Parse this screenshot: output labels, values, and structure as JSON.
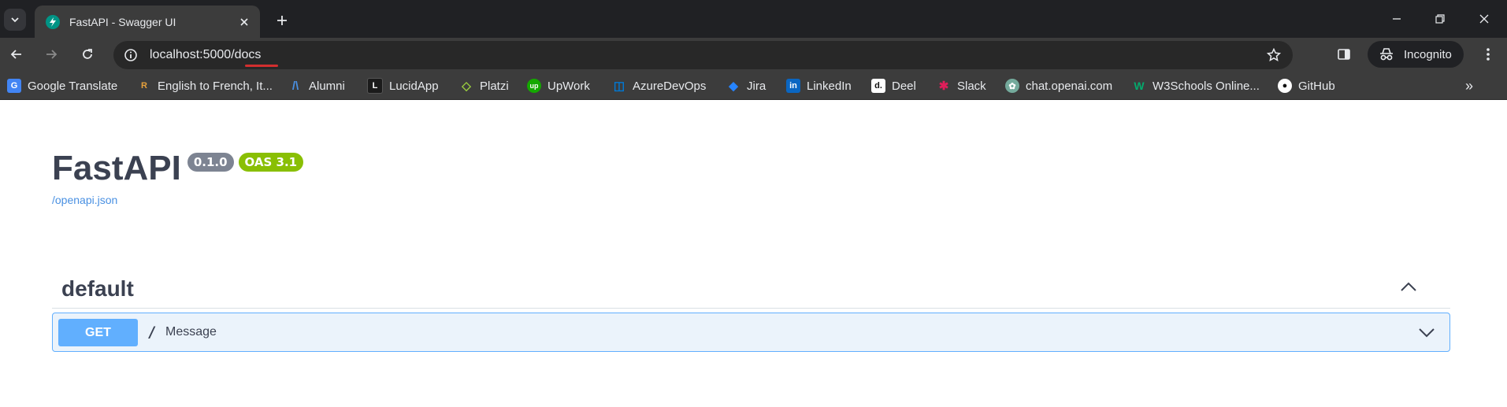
{
  "browser": {
    "tab": {
      "title": "FastAPI - Swagger UI"
    },
    "url": {
      "host": "localhost:5000",
      "path": "/docs"
    },
    "profile_label": "Incognito",
    "bookmarks": [
      {
        "label": "Google Translate",
        "icon": "google-translate-icon",
        "color": "#4285f4"
      },
      {
        "label": "English to French, It...",
        "icon": "reverso-icon",
        "color": "#e8eaed"
      },
      {
        "label": "Alumni",
        "icon": "alumni-icon",
        "color": "#4a90e2"
      },
      {
        "label": "LucidApp",
        "icon": "lucid-icon",
        "color": "#282c33"
      },
      {
        "label": "Platzi",
        "icon": "platzi-icon",
        "color": "#98ca3f"
      },
      {
        "label": "UpWork",
        "icon": "upwork-icon",
        "color": "#14a800"
      },
      {
        "label": "AzureDevOps",
        "icon": "azure-devops-icon",
        "color": "#0078d4"
      },
      {
        "label": "Jira",
        "icon": "jira-icon",
        "color": "#2684ff"
      },
      {
        "label": "LinkedIn",
        "icon": "linkedin-icon",
        "color": "#0a66c2"
      },
      {
        "label": "Deel",
        "icon": "deel-icon",
        "color": "#ffffff"
      },
      {
        "label": "Slack",
        "icon": "slack-icon",
        "color": "#e01e5a"
      },
      {
        "label": "chat.openai.com",
        "icon": "openai-icon",
        "color": "#74aa9c"
      },
      {
        "label": "W3Schools Online...",
        "icon": "w3schools-icon",
        "color": "#04aa6d"
      },
      {
        "label": "GitHub",
        "icon": "github-icon",
        "color": "#ffffff"
      }
    ]
  },
  "swagger": {
    "title": "FastAPI",
    "version": "0.1.0",
    "oas": "OAS 3.1",
    "spec_link": "/openapi.json",
    "section": {
      "title": "default"
    },
    "operation": {
      "method": "GET",
      "path": "/",
      "summary": "Message"
    },
    "colors": {
      "get": "#61affe",
      "get_bg": "#ebf3fb",
      "version_badge": "#7d8492",
      "oas_badge": "#89bf04"
    }
  }
}
